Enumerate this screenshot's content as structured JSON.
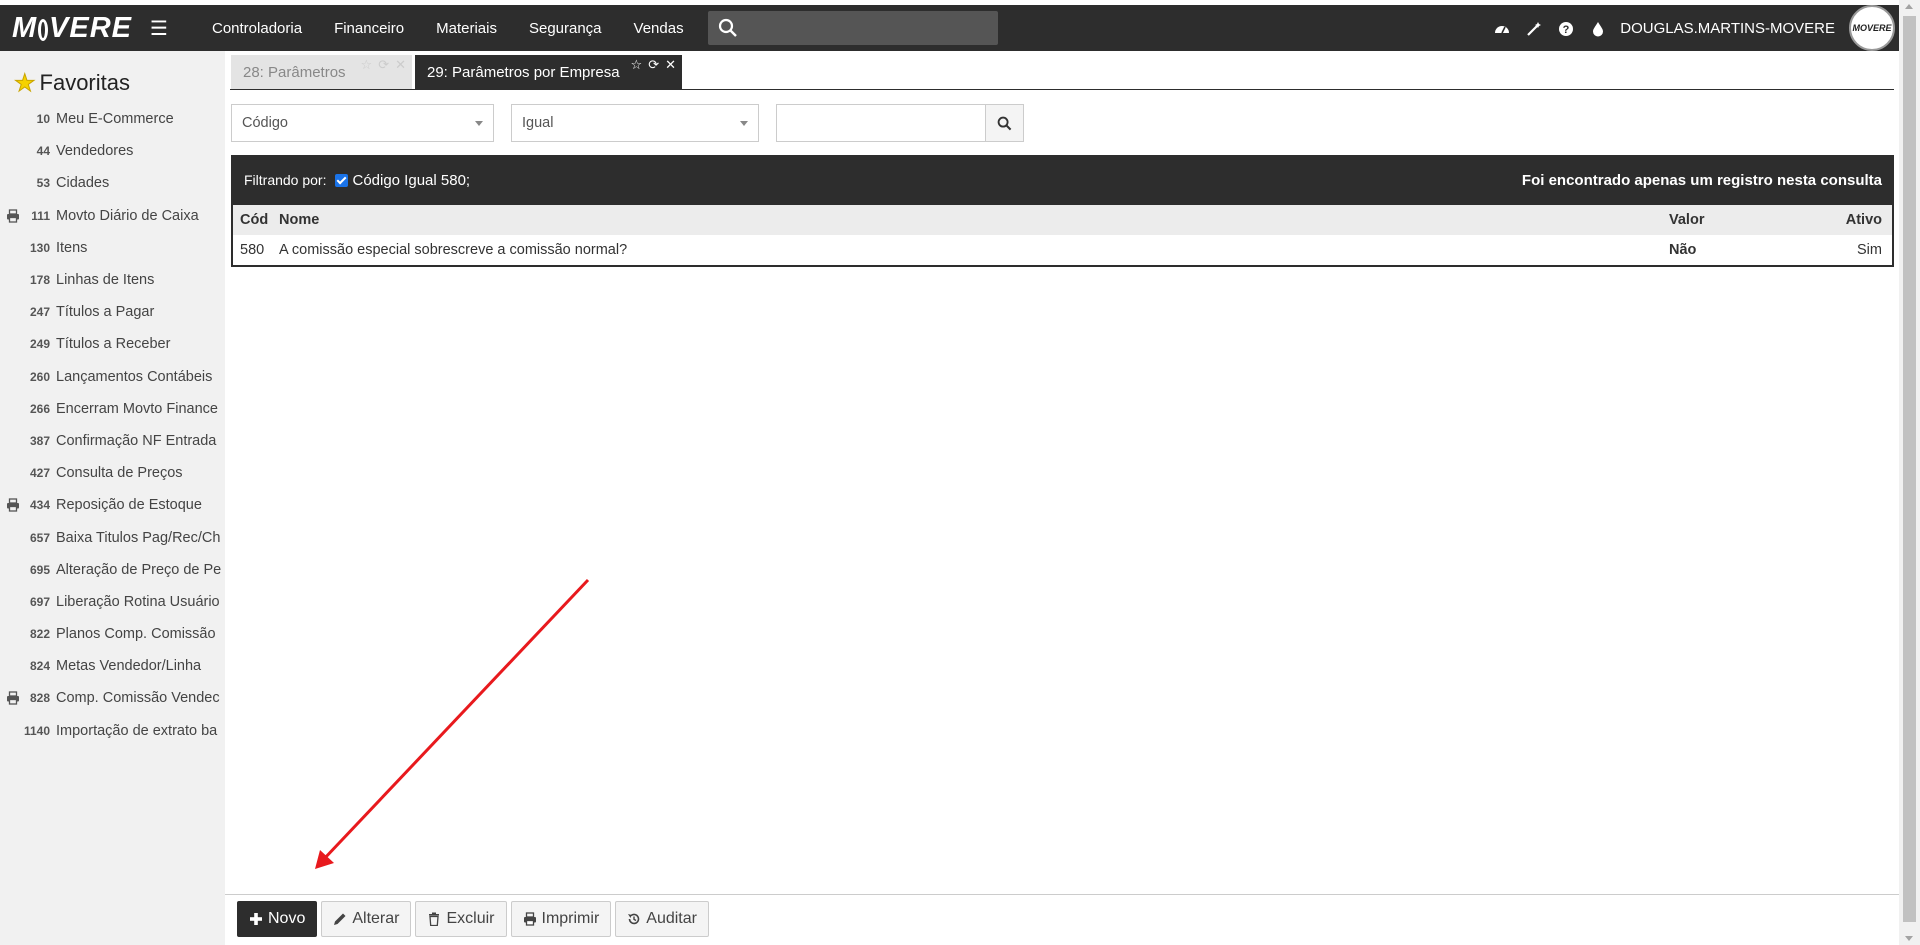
{
  "app": {
    "logo": "MOVERE"
  },
  "nav": [
    "Controladoria",
    "Financeiro",
    "Materiais",
    "Segurança",
    "Vendas"
  ],
  "user": {
    "name": "DOUGLAS.MARTINS-MOVERE",
    "avatar_text": "MOVERE"
  },
  "sidebar": {
    "title": "Favoritas",
    "items": [
      {
        "code": "10",
        "label": "Meu E-Commerce",
        "icon": ""
      },
      {
        "code": "44",
        "label": "Vendedores",
        "icon": ""
      },
      {
        "code": "53",
        "label": "Cidades",
        "icon": ""
      },
      {
        "code": "111",
        "label": "Movto Diário de Caixa",
        "icon": "printer-icon"
      },
      {
        "code": "130",
        "label": "Itens",
        "icon": ""
      },
      {
        "code": "178",
        "label": "Linhas de Itens",
        "icon": ""
      },
      {
        "code": "247",
        "label": "Títulos a Pagar",
        "icon": ""
      },
      {
        "code": "249",
        "label": "Títulos a Receber",
        "icon": ""
      },
      {
        "code": "260",
        "label": "Lançamentos Contábeis",
        "icon": ""
      },
      {
        "code": "266",
        "label": "Encerram Movto Finance",
        "icon": ""
      },
      {
        "code": "387",
        "label": "Confirmação NF Entrada",
        "icon": ""
      },
      {
        "code": "427",
        "label": "Consulta de Preços",
        "icon": ""
      },
      {
        "code": "434",
        "label": "Reposição de Estoque",
        "icon": "printer-icon"
      },
      {
        "code": "657",
        "label": "Baixa Titulos Pag/Rec/Ch",
        "icon": ""
      },
      {
        "code": "695",
        "label": "Alteração de Preço de Pe",
        "icon": ""
      },
      {
        "code": "697",
        "label": "Liberação Rotina Usuário",
        "icon": ""
      },
      {
        "code": "822",
        "label": "Planos Comp. Comissão",
        "icon": ""
      },
      {
        "code": "824",
        "label": "Metas Vendedor/Linha",
        "icon": ""
      },
      {
        "code": "828",
        "label": "Comp. Comissão Vendec",
        "icon": "printer-icon"
      },
      {
        "code": "1140",
        "label": "Importação de extrato ba",
        "icon": ""
      }
    ]
  },
  "tabs": [
    {
      "label": "28: Parâmetros",
      "active": false
    },
    {
      "label": "29: Parâmetros por Empresa",
      "active": true
    }
  ],
  "filter": {
    "field": "Código",
    "operator": "Igual",
    "value": "",
    "filtering_label": "Filtrando por:",
    "applied": "Código Igual 580;",
    "result_text": "Foi encontrado apenas um registro nesta consulta"
  },
  "grid": {
    "columns": {
      "cod": "Cód",
      "nome": "Nome",
      "valor": "Valor",
      "ativo": "Ativo"
    },
    "rows": [
      {
        "cod": "580",
        "nome": "A comissão especial sobrescreve a comissão normal?",
        "valor": "Não",
        "ativo": "Sim"
      }
    ]
  },
  "buttons": {
    "novo": "Novo",
    "alterar": "Alterar",
    "excluir": "Excluir",
    "imprimir": "Imprimir",
    "auditar": "Auditar"
  },
  "colors": {
    "bar": "#2d2d2d",
    "sidebar": "#f1f1f1",
    "annotation_arrow": "#e8191d",
    "star": "#f6d200"
  }
}
